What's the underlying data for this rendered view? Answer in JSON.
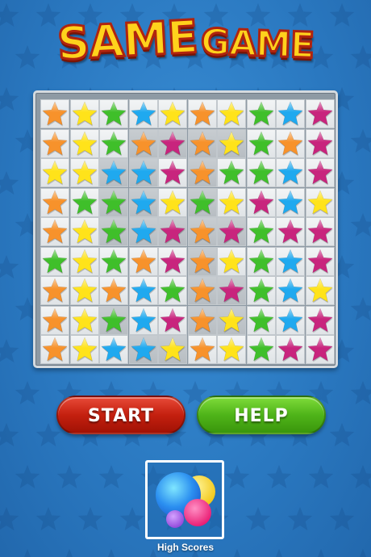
{
  "title": {
    "word1": "SAME",
    "word2": "GAME"
  },
  "colors": {
    "O": "#f7922b",
    "Y": "#ffe31a",
    "G": "#3fbf2a",
    "B": "#1fa9ef",
    "M": "#c8247d"
  },
  "board": {
    "rows": [
      "OYGBYOYGBM",
      "OYGOMOYGOM",
      "YYBBMOGGBM",
      "OGGBYGYMBY",
      "OYGBMOMGMM",
      "GYGOMOYGBM",
      "OYOBGOMGBY",
      "OYGBMOYGBM",
      "OYBBYOYGMM"
    ],
    "highlighted_cells": [
      [
        1,
        3
      ],
      [
        1,
        4
      ],
      [
        1,
        5
      ],
      [
        1,
        6
      ],
      [
        2,
        3
      ],
      [
        2,
        5
      ],
      [
        3,
        3
      ],
      [
        3,
        5
      ],
      [
        4,
        3
      ],
      [
        4,
        4
      ],
      [
        4,
        5
      ],
      [
        4,
        6
      ],
      [
        5,
        5
      ],
      [
        6,
        5
      ],
      [
        7,
        5
      ],
      [
        6,
        6
      ],
      [
        7,
        6
      ],
      [
        8,
        3
      ],
      [
        8,
        4
      ],
      [
        2,
        2
      ],
      [
        3,
        2
      ],
      [
        4,
        2
      ],
      [
        7,
        2
      ]
    ]
  },
  "buttons": {
    "start": "START",
    "help": "HELP"
  },
  "high_scores": {
    "label": "High Scores",
    "icon": "game-center-bubbles-icon"
  }
}
